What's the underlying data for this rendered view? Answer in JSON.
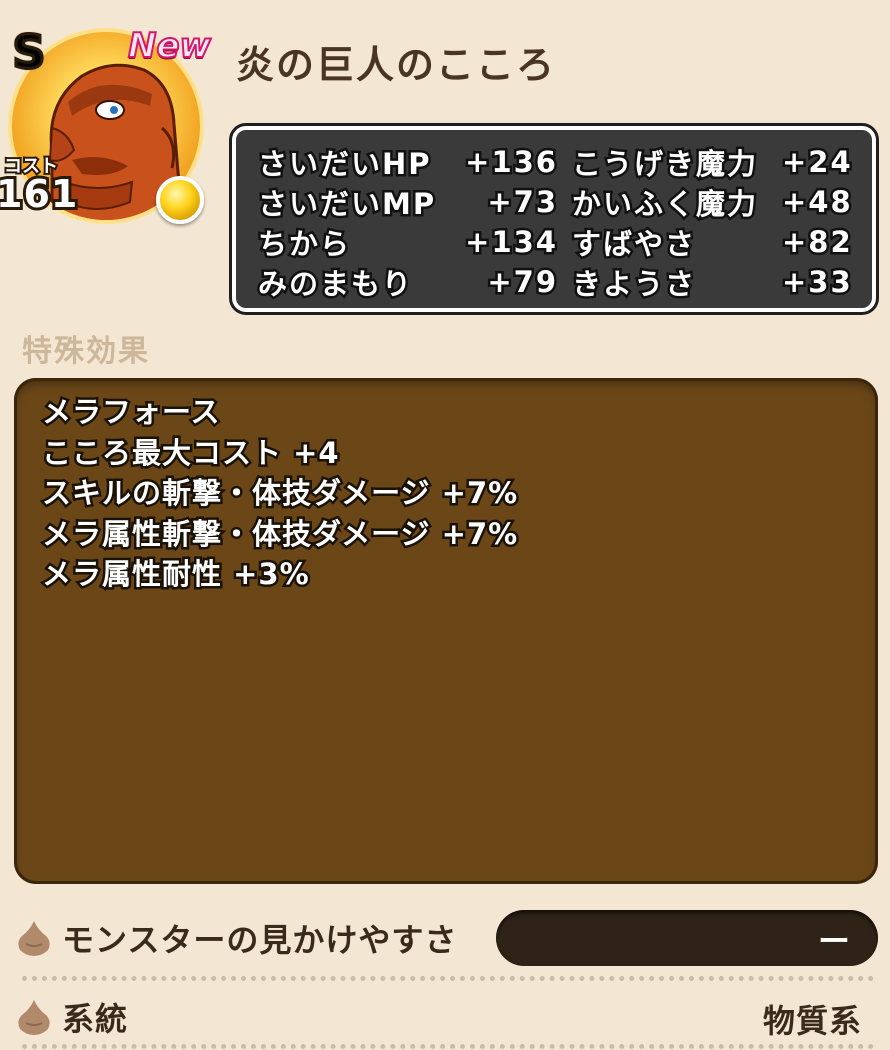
{
  "header": {
    "rank": "S",
    "new_badge": "New",
    "cost_label": "コスト",
    "cost_value": "161",
    "title": "炎の巨人のこころ"
  },
  "stats": [
    {
      "name": "さいだいHP",
      "value": "+136",
      "name2": "こうげき魔力",
      "value2": "+24"
    },
    {
      "name": "さいだいMP",
      "value": "+73",
      "name2": "かいふく魔力",
      "value2": "+48"
    },
    {
      "name": "ちから",
      "value": "+134",
      "name2": "すばやさ",
      "value2": "+82"
    },
    {
      "name": "みのまもり",
      "value": "+79",
      "name2": "きようさ",
      "value2": "+33"
    }
  ],
  "special_effects": {
    "label": "特殊効果",
    "items": [
      "メラフォース",
      "こころ最大コスト +4",
      "スキルの斬撃・体技ダメージ +7%",
      "メラ属性斬撃・体技ダメージ +7%",
      "メラ属性耐性 +3%"
    ]
  },
  "visibility": {
    "label": "モンスターの見かけやすさ",
    "value": "ー"
  },
  "lineage": {
    "label": "系統",
    "value": "物質系"
  },
  "colors": {
    "background": "#f3e6d2",
    "stats_panel": "#3a3a3a",
    "effects_panel": "#6b4718",
    "title_text": "#4a3524"
  },
  "icons": {
    "rank": "rank-s-icon",
    "orb": "gold-orb-icon",
    "row_bullet": "drop-icon"
  }
}
